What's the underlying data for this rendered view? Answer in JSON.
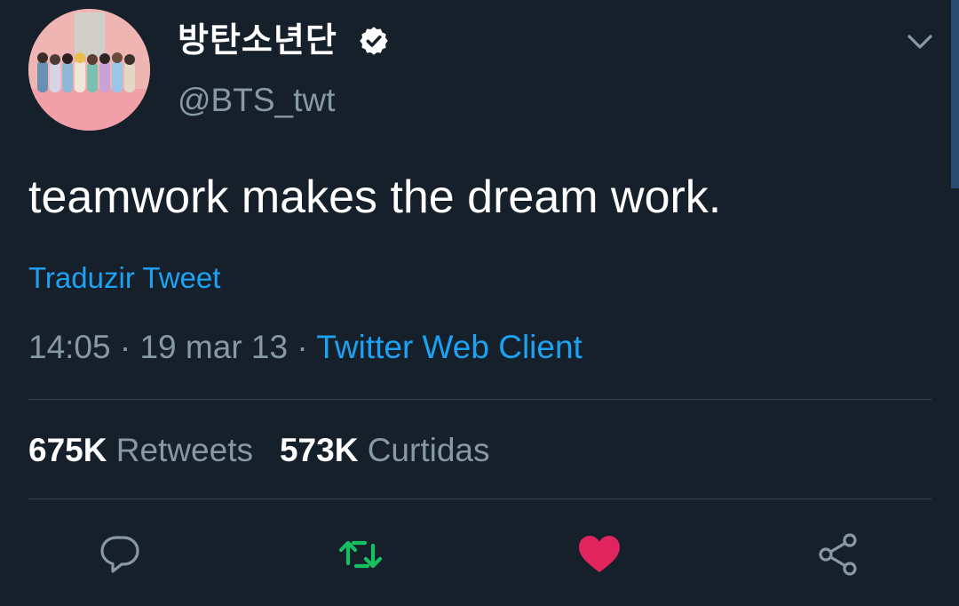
{
  "tweet": {
    "author": {
      "display_name": "방탄소년단",
      "handle": "@BTS_twt",
      "verified": true
    },
    "text": "teamwork makes the dream work.",
    "translate_label": "Traduzir Tweet",
    "time": "14:05",
    "date": "19 mar 13",
    "separator": "·",
    "source": "Twitter Web Client",
    "stats": {
      "retweets_count": "675K",
      "retweets_label": "Retweets",
      "likes_count": "573K",
      "likes_label": "Curtidas"
    }
  },
  "actions": [
    {
      "name": "reply",
      "icon": "reply-icon"
    },
    {
      "name": "retweet",
      "icon": "retweet-icon",
      "active_color": "#17bf63"
    },
    {
      "name": "like",
      "icon": "heart-icon",
      "active_color": "#e0245e"
    },
    {
      "name": "share",
      "icon": "share-icon"
    }
  ],
  "colors": {
    "background": "#15202b",
    "link": "#1da1f2",
    "secondary_text": "#8899a6",
    "divider": "#38444d"
  }
}
